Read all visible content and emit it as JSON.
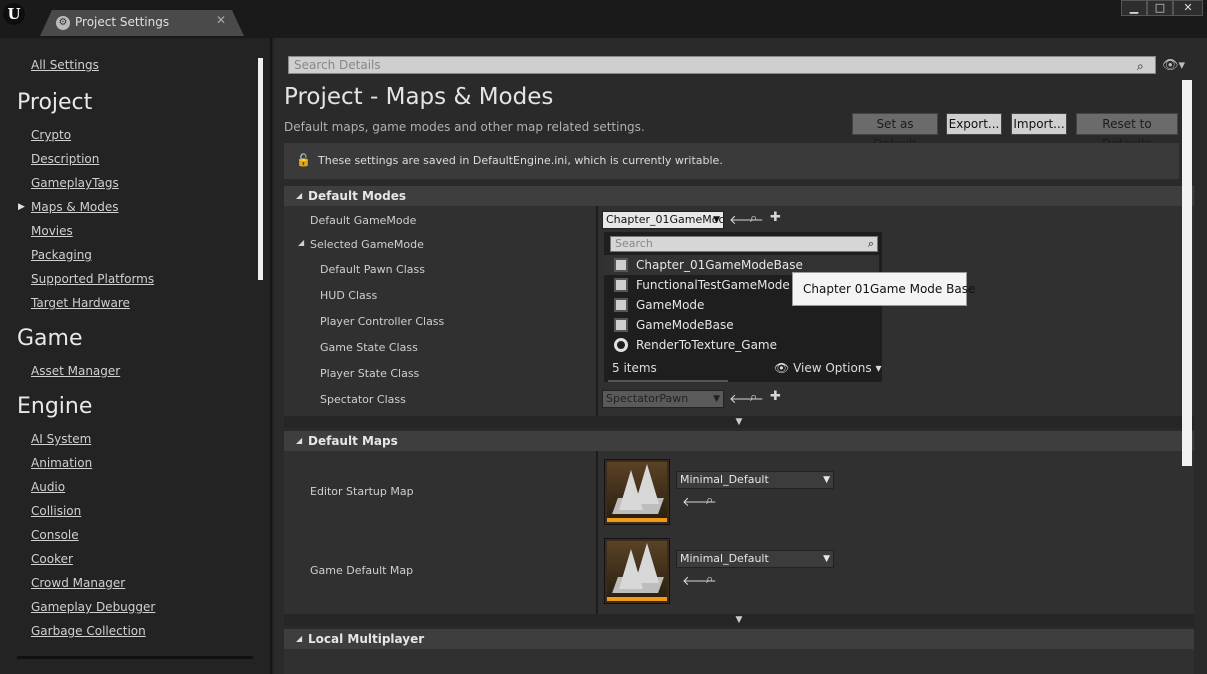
{
  "window": {
    "tab_title": "Project Settings",
    "tab_close": "✕",
    "min": "▁",
    "max": "□",
    "close": "✕"
  },
  "sidebar": {
    "all_settings": "All Settings",
    "sections": [
      {
        "title": "Project",
        "items": [
          "Crypto",
          "Description",
          "GameplayTags",
          "Maps & Modes",
          "Movies",
          "Packaging",
          "Supported Platforms",
          "Target Hardware"
        ]
      },
      {
        "title": "Game",
        "items": [
          "Asset Manager"
        ]
      },
      {
        "title": "Engine",
        "items": [
          "AI System",
          "Animation",
          "Audio",
          "Collision",
          "Console",
          "Cooker",
          "Crowd Manager",
          "Gameplay Debugger",
          "Garbage Collection"
        ]
      }
    ]
  },
  "search": {
    "placeholder": "Search Details"
  },
  "header": {
    "title": "Project - Maps & Modes",
    "subtitle": "Default maps, game modes and other map related settings.",
    "buttons": [
      "Set as Default",
      "Export...",
      "Import...",
      "Reset to Defaults"
    ]
  },
  "notice": {
    "text": "These settings are saved in DefaultEngine.ini, which is currently writable."
  },
  "default_modes": {
    "title": "Default Modes",
    "default_gamemode_label": "Default GameMode",
    "default_gamemode_value": "Chapter_01GameMoc",
    "selected_gamemode_label": "Selected GameMode",
    "props": [
      "Default Pawn Class",
      "HUD Class",
      "Player Controller Class",
      "Game State Class",
      "Player State Class",
      "Spectator Class"
    ],
    "spectator_value": "SpectatorPawn"
  },
  "dropdown": {
    "search_placeholder": "Search",
    "items": [
      "Chapter_01GameModeBase",
      "FunctionalTestGameMode",
      "GameMode",
      "GameModeBase",
      "RenderToTexture_Game"
    ],
    "count": "5 items",
    "view_options": "View Options"
  },
  "tooltip": "Chapter 01Game Mode Base",
  "default_maps": {
    "title": "Default Maps",
    "editor_startup_label": "Editor Startup Map",
    "editor_startup_value": "Minimal_Default",
    "game_default_label": "Game Default Map",
    "game_default_value": "Minimal_Default"
  },
  "local_multiplayer": {
    "title": "Local Multiplayer"
  }
}
